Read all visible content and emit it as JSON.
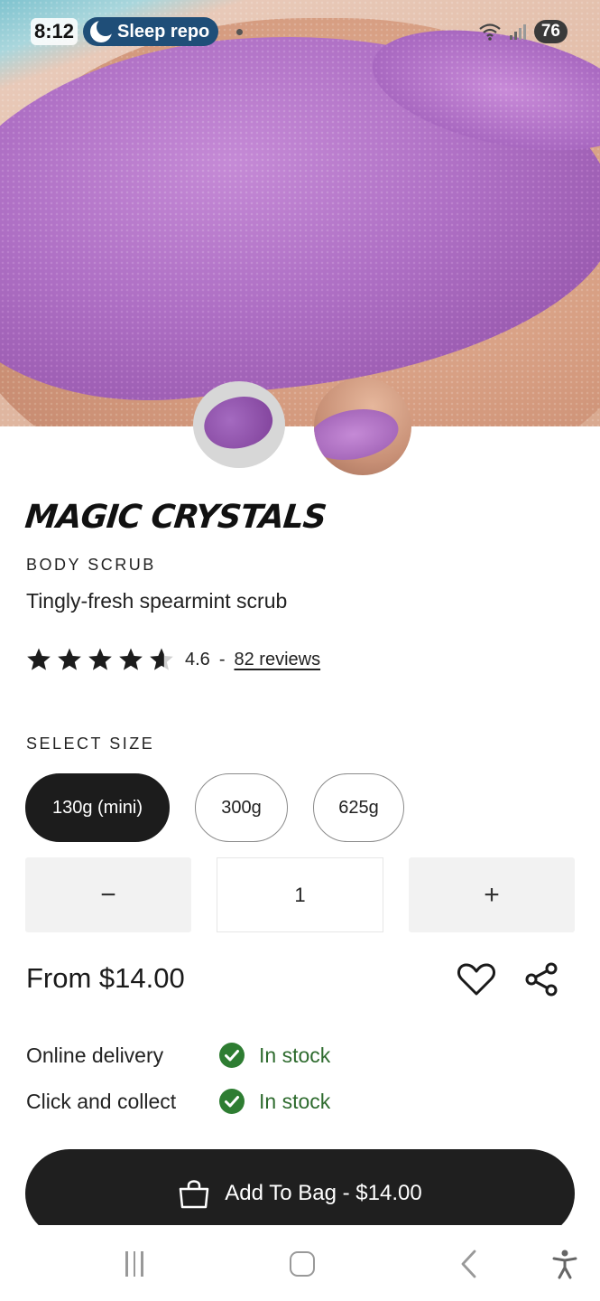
{
  "status_bar": {
    "time": "8:12",
    "notification": "Sleep repo",
    "battery": "76",
    "signal_label": "5"
  },
  "product": {
    "name": "MAGIC CRYSTALS",
    "category": "BODY SCRUB",
    "tagline": "Tingly-fresh spearmint scrub",
    "rating": {
      "stars": 4.6,
      "value": "4.6",
      "separator": "-",
      "reviews_label": "82 reviews"
    }
  },
  "size_selector": {
    "title": "SELECT SIZE",
    "options": [
      "130g (mini)",
      "300g",
      "625g"
    ],
    "selected": "130g (mini)"
  },
  "quantity": {
    "minus_label": "−",
    "value": "1",
    "plus_label": "+"
  },
  "price": {
    "label": "From $14.00"
  },
  "actions": {
    "wishlist_icon": "heart-icon",
    "share_icon": "share-icon"
  },
  "availability": [
    {
      "label": "Online delivery",
      "status": "In stock"
    },
    {
      "label": "Click and collect",
      "status": "In stock"
    }
  ],
  "add_to_bag": {
    "label": "Add To Bag - $14.00"
  },
  "colors": {
    "primary_dark": "#1c1c1c",
    "in_stock_green": "#2e7d32",
    "quantity_bg": "#f2f2f2",
    "scrub_purple": "#ae6fc4"
  }
}
